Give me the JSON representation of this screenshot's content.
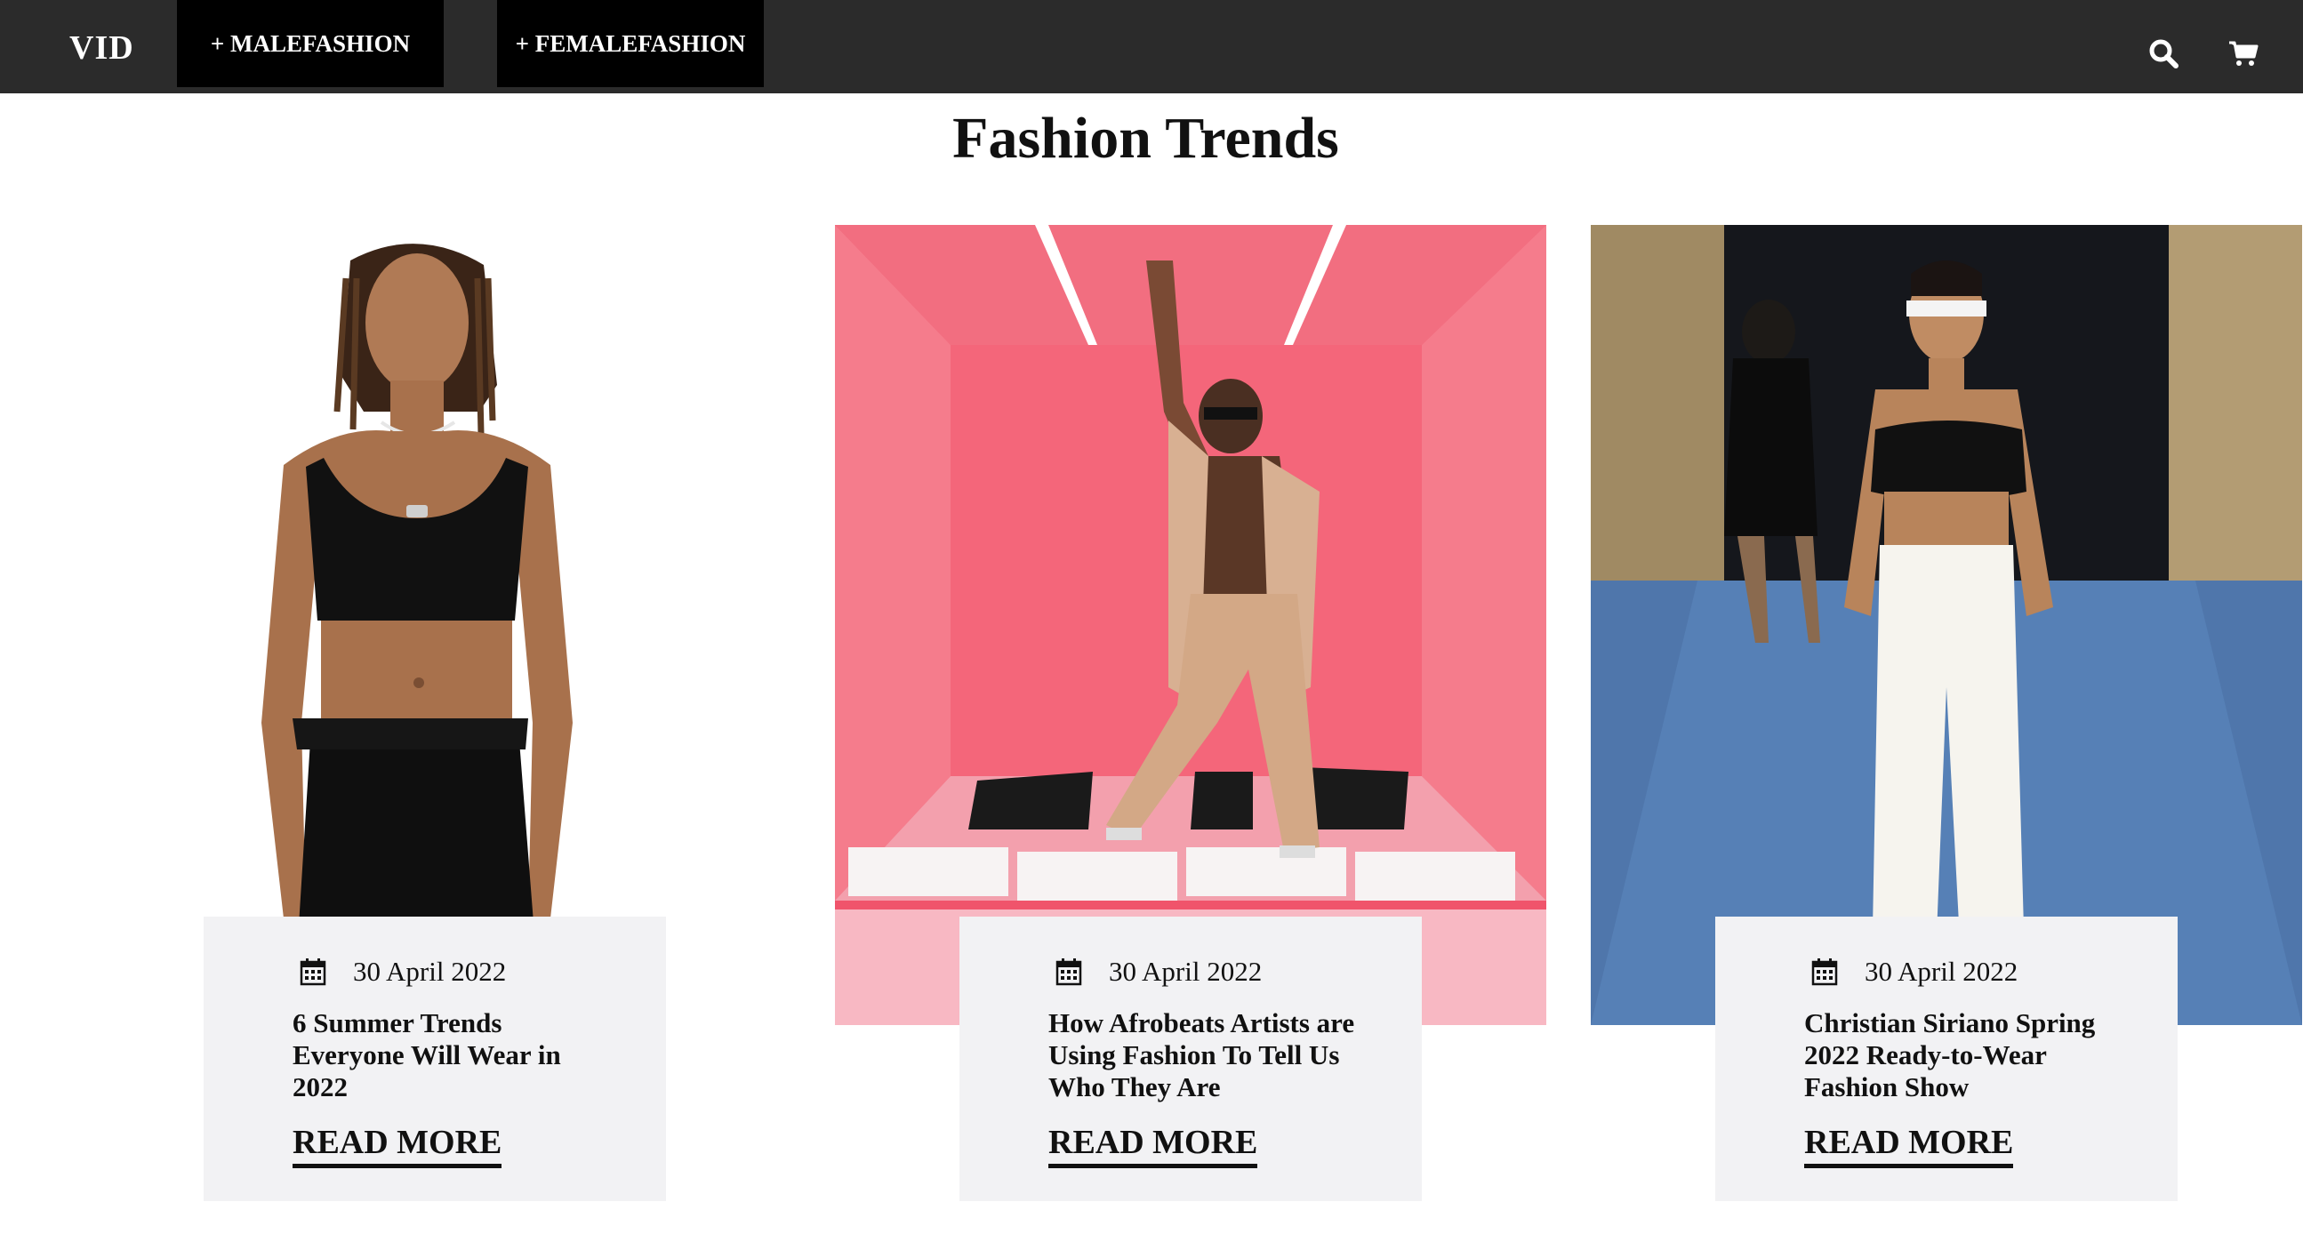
{
  "nav": {
    "brand": "VID",
    "male_label": "+ MALEFASHION",
    "female_label": "+ FEMALEFASHION",
    "search_icon": "search-icon",
    "cart_icon": "cart-icon"
  },
  "main": {
    "title": "Fashion Trends",
    "cards": [
      {
        "date": "30 April 2022",
        "title": "6 Summer Trends Everyone Will Wear in 2022",
        "read_more": "READ MORE",
        "image": "woman in black crop top and black trousers"
      },
      {
        "date": "30 April 2022",
        "title": "How Afrobeats Artists are Using Fashion To Tell Us Who They Are",
        "read_more": "READ MORE",
        "image": "man in beige suit posing on piano keys in pink room"
      },
      {
        "date": "30 April 2022",
        "title": "Christian Siriano Spring 2022 Ready-to-Wear Fashion Show",
        "read_more": "READ MORE",
        "image": "model in black top and white trousers on runway"
      }
    ]
  },
  "colors": {
    "nav_bg": "#2b2b2b",
    "nav_button_bg": "#000000",
    "card_bg": "#f2f2f4",
    "pink_room": "#f0546b"
  }
}
